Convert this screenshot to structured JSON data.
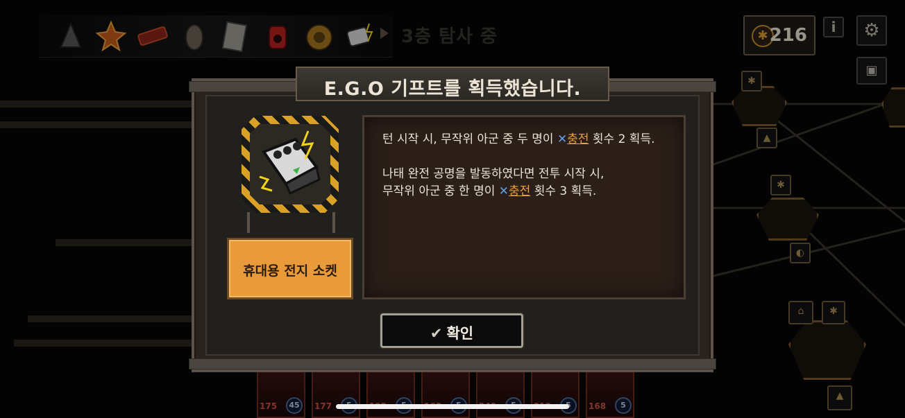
{
  "top_bar": {
    "gifts": [
      "ego-gift-icon-1",
      "ego-gift-icon-2",
      "ego-gift-icon-3",
      "ego-gift-icon-4",
      "ego-gift-icon-5",
      "ego-gift-icon-6",
      "ego-gift-icon-7",
      "ego-gift-icon-8"
    ],
    "floor_status": "3층 탐사 중",
    "currency_value": "216"
  },
  "dialog": {
    "title": "E.G.O 기프트를 획득했습니다.",
    "gift_name": "휴대용 전지 소켓",
    "description": {
      "p1_prefix": "턴 시작 시, 무작위 아군 중 두 명이 ",
      "p1_keyword": "충전",
      "p1_suffix": " 횟수 2 획득.",
      "p2_line1": "나태 완전 공명을 발동하였다면 전투 시작 시,",
      "p2_prefix": "무작위 아군 중 한 명이 ",
      "p2_keyword": "충전",
      "p2_suffix": " 횟수 3 획득."
    },
    "confirm_label": "확인"
  },
  "party": [
    {
      "hp": "175",
      "sp": "45"
    },
    {
      "hp": "177",
      "sp": "5"
    },
    {
      "hp": "192",
      "sp": "5"
    },
    {
      "hp": "168",
      "sp": "5"
    },
    {
      "hp": "240",
      "sp": "5"
    },
    {
      "hp": "219",
      "sp": "5"
    },
    {
      "hp": "168",
      "sp": "5"
    }
  ],
  "colors": {
    "keyword": "#e9a23b",
    "name_plate": "#e99a3a",
    "hazard_yellow": "#d9a126"
  }
}
